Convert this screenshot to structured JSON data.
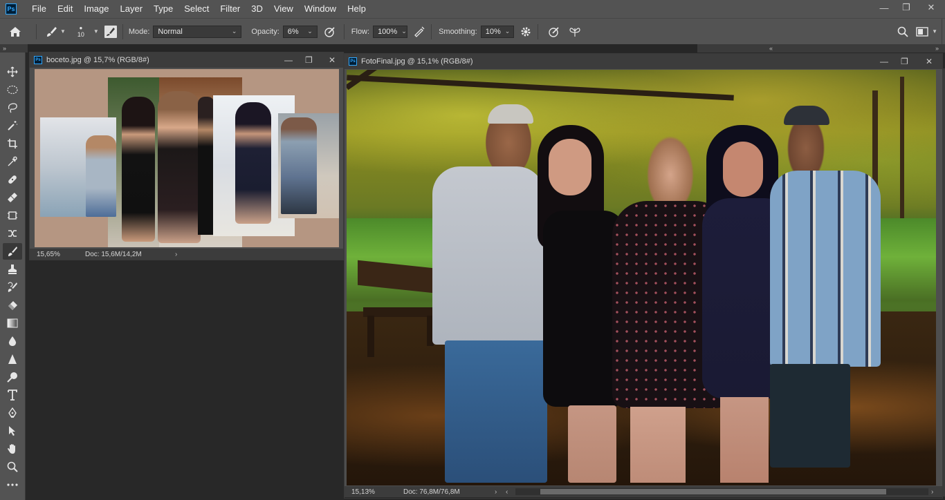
{
  "app": {
    "logo": "Ps"
  },
  "menu": [
    "File",
    "Edit",
    "Image",
    "Layer",
    "Type",
    "Select",
    "Filter",
    "3D",
    "View",
    "Window",
    "Help"
  ],
  "window_controls": {
    "minimize": "—",
    "restore": "❐",
    "close": "✕"
  },
  "options": {
    "brush_size": "10",
    "mode_label": "Mode:",
    "mode_value": "Normal",
    "opacity_label": "Opacity:",
    "opacity_value": "6%",
    "flow_label": "Flow:",
    "flow_value": "100%",
    "smoothing_label": "Smoothing:",
    "smoothing_value": "10%"
  },
  "docs": {
    "boceto": {
      "title": "boceto.jpg @ 15,7% (RGB/8#)",
      "zoom": "15,65%",
      "doc_size": "Doc: 15,6M/14,2M"
    },
    "fotofinal": {
      "title": "FotoFinal.jpg @ 15,1% (RGB/8#)",
      "zoom": "15,13%",
      "doc_size": "Doc: 76,8M/76,8M"
    }
  },
  "icons": {
    "home": "⌂",
    "search": "🔍",
    "gear": "⚙",
    "tools": [
      "move-icon",
      "marquee-icon",
      "lasso-icon",
      "magic-wand-icon",
      "crop-icon",
      "eyedropper-icon",
      "healing-icon",
      "patch-icon",
      "frame-icon",
      "content-aware-icon",
      "brush-icon",
      "stamp-icon",
      "history-brush-icon",
      "eraser-icon",
      "gradient-icon",
      "blur-icon",
      "sharpen-icon",
      "dodge-icon",
      "type-icon",
      "pen-icon",
      "path-select-icon",
      "hand-icon",
      "zoom-icon",
      "more-icon"
    ]
  },
  "colors": {
    "ps_blue": "#31a8ff",
    "ui_bg": "#535353",
    "panel_bg": "#282828"
  }
}
